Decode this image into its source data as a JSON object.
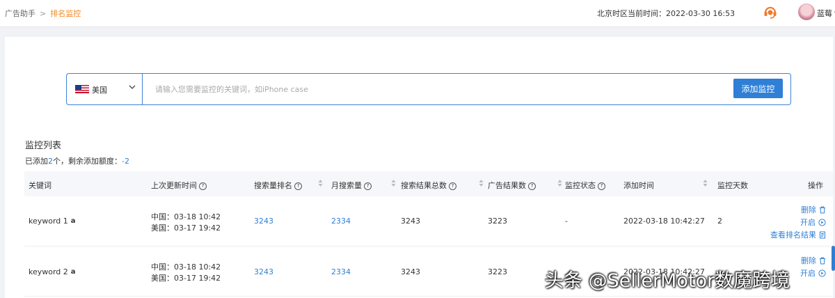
{
  "header": {
    "breadcrumb": [
      "广告助手",
      "排名监控"
    ],
    "breadcrumb_sep": ">",
    "time_label": "北京时区当前时间：",
    "time_value": "2022-03-30 16:53",
    "user_name": "蓝莓丶"
  },
  "search": {
    "country": "美国",
    "placeholder": "请输入您需要监控的关键词，如iPhone case",
    "add_label": "添加监控"
  },
  "list": {
    "title": "监控列表",
    "quota_prefix": "已添加",
    "quota_count": "2",
    "quota_mid": "个，剩余添加额度：",
    "quota_remaining": "-2"
  },
  "columns": [
    "关键词",
    "上次更新时间",
    "搜索量排名",
    "月搜索量",
    "搜索结果总数",
    "广告结果数",
    "监控状态",
    "添加时间",
    "监控天数",
    "操作"
  ],
  "rows": [
    {
      "keyword": "keyword 1",
      "update_cn": "中国：03-18 10:42",
      "update_us": "美国：03-17 19:42",
      "rank": "3243",
      "monthly": "2334",
      "results": "3243",
      "ads": "3223",
      "status": "-",
      "added": "2022-03-18 10:42:27",
      "days": "2",
      "actions": [
        "删除",
        "开启",
        "查看排名结果"
      ]
    },
    {
      "keyword": "keyword 2",
      "update_cn": "中国：03-18 10:42",
      "update_us": "美国：03-17 19:42",
      "rank": "3243",
      "monthly": "2334",
      "results": "3243",
      "ads": "3223",
      "status": "",
      "added": "2022-03-18 10:42:27",
      "days": "",
      "actions": [
        "删除",
        "开启"
      ]
    }
  ],
  "watermark": "头条 @SellerMotor数魔跨境",
  "colors": {
    "accent": "#2f7fd6",
    "breadcrumb_active": "#f08a24"
  }
}
